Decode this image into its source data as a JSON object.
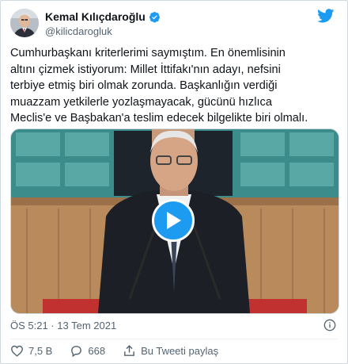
{
  "tweet": {
    "author_name": "Kemal Kılıçdaroğlu",
    "author_handle": "@kilicdarogluk",
    "text_lines": [
      "Cumhurbaşkanı kriterlerimi saymıştım. En önemlisinin",
      "altını çizmek istiyorum: Millet İttifakı'nın adayı, nefsini",
      "terbiye etmiş biri olmak zorunda. Başkanlığın verdiği",
      "muazzam yetkilerle yozlaşmayacak, gücünü hızlıca",
      "Meclis'e ve Başbakan'a teslim edecek bilgelikte biri olmalı."
    ],
    "timestamp": "ÖS 5:21 · 13 Tem 2021",
    "likes": "7,5 B",
    "replies": "668",
    "share_label": "Bu Tweeti paylaş"
  },
  "icons": {
    "verified": "verified-badge-icon",
    "brand": "twitter-bird-icon",
    "play": "play-icon",
    "info": "info-icon",
    "like": "heart-icon",
    "reply": "reply-bubble-icon",
    "share": "share-icon"
  },
  "colors": {
    "accent": "#1d9bf0",
    "text": "#0f1419",
    "secondary": "#536471"
  }
}
